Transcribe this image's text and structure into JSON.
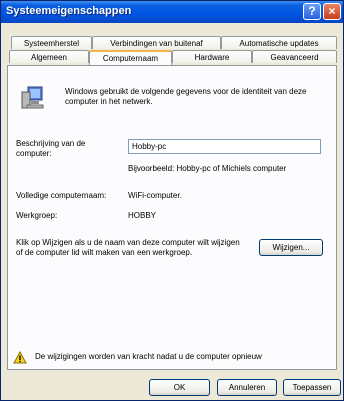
{
  "window": {
    "title": "Systeemeigenschappen"
  },
  "titlebar": {
    "help_glyph": "?",
    "close_glyph": "×"
  },
  "tabs": {
    "row1": [
      "Systeemherstel",
      "Verbindingen van buitenaf",
      "Automatische updates"
    ],
    "row2": [
      "Algemeen",
      "Computernaam",
      "Hardware",
      "Geavanceerd"
    ],
    "active": "Computernaam"
  },
  "content": {
    "intro": "Windows gebruikt de volgende gegevens voor de identiteit van deze computer in het netwerk.",
    "description_label": "Beschrijving van de computer:",
    "description_value": "Hobby-pc",
    "example": "Bijvoorbeeld: Hobby-pc of Michiels computer",
    "fullname_label": "Volledige computernaam:",
    "fullname_value": "WiFi-computer.",
    "workgroup_label": "Werkgroep:",
    "workgroup_value": "HOBBY",
    "change_text": "Klik op Wijzigen als u de naam van deze computer wilt wijzigen of de computer lid wilt maken van een werkgroep.",
    "change_button": "Wijzigen...",
    "warning_text": "De wijzigingen worden van kracht nadat u de computer opnieuw"
  },
  "buttons": {
    "ok": "OK",
    "cancel": "Annuleren",
    "apply": "Toepassen"
  },
  "icons": {
    "computer": "computer-icon",
    "warning": "warning-icon"
  }
}
